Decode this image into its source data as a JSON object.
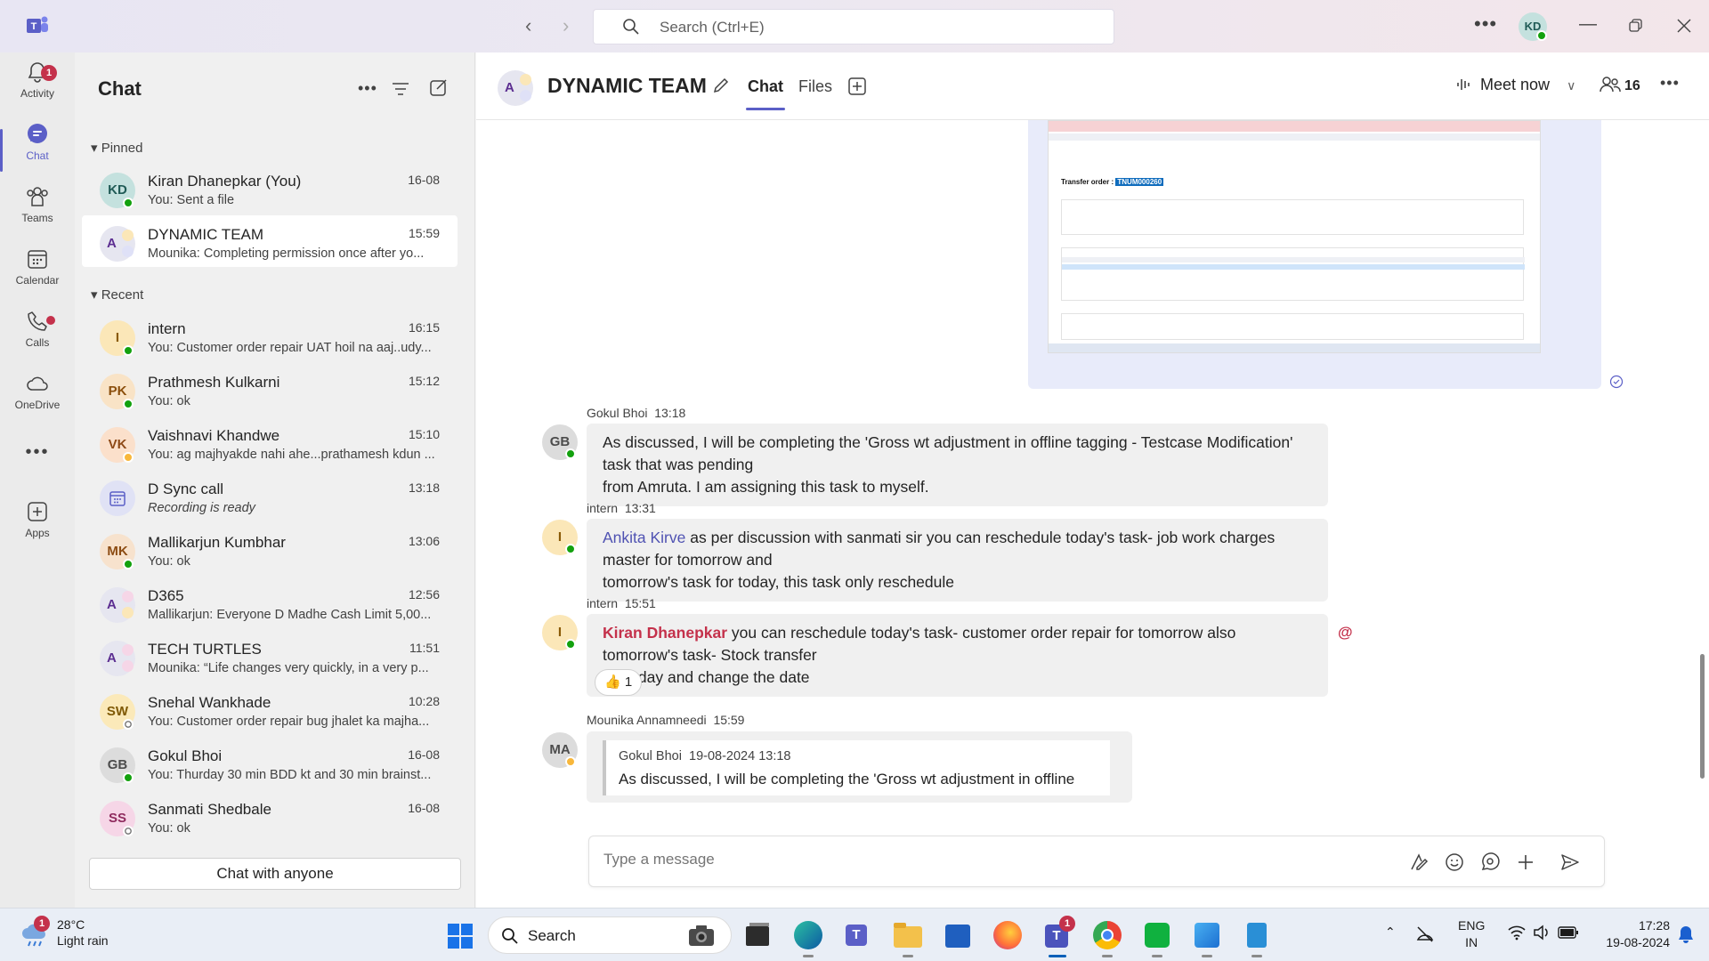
{
  "titlebar": {
    "search_placeholder": "Search (Ctrl+E)",
    "avatar": "KD"
  },
  "rail": {
    "items": [
      {
        "label": "Activity",
        "badge": "1"
      },
      {
        "label": "Chat"
      },
      {
        "label": "Teams"
      },
      {
        "label": "Calendar"
      },
      {
        "label": "Calls"
      },
      {
        "label": "OneDrive"
      },
      {
        "label": "..."
      },
      {
        "label": "Apps"
      }
    ]
  },
  "chatlist": {
    "title": "Chat",
    "pinned_label": "Pinned",
    "recent_label": "Recent",
    "pinned": [
      {
        "initials": "KD",
        "name": "Kiran Dhanepkar (You)",
        "time": "16-08",
        "preview": "You: Sent a file"
      },
      {
        "initials": "A",
        "name": "DYNAMIC TEAM",
        "time": "15:59",
        "preview": "Mounika: Completing permission once after yo..."
      }
    ],
    "recent": [
      {
        "initials": "I",
        "name": "intern",
        "time": "16:15",
        "preview": "You: Customer order repair UAT hoil na aaj..udy..."
      },
      {
        "initials": "PK",
        "name": "Prathmesh Kulkarni",
        "time": "15:12",
        "preview": "You: ok"
      },
      {
        "initials": "VK",
        "name": "Vaishnavi Khandwe",
        "time": "15:10",
        "preview": "You: ag majhyakde nahi ahe...prathamesh kdun ..."
      },
      {
        "initials": "",
        "name": "D Sync call",
        "time": "13:18",
        "preview": "Recording is ready"
      },
      {
        "initials": "MK",
        "name": "Mallikarjun Kumbhar",
        "time": "13:06",
        "preview": "You: ok"
      },
      {
        "initials": "A",
        "name": "D365",
        "time": "12:56",
        "preview": "Mallikarjun: Everyone D Madhe Cash Limit  5,00..."
      },
      {
        "initials": "A",
        "name": "TECH TURTLES",
        "time": "11:51",
        "preview": "Mounika: “Life changes very quickly, in a very p..."
      },
      {
        "initials": "SW",
        "name": "Snehal Wankhade",
        "time": "10:28",
        "preview": "You: Customer order repair bug jhalet ka majha..."
      },
      {
        "initials": "GB",
        "name": "Gokul Bhoi",
        "time": "16-08",
        "preview": "You: Thurday 30 min BDD kt and 30 min brainst..."
      },
      {
        "initials": "SS",
        "name": "Sanmati Shedbale",
        "time": "16-08",
        "preview": "You: ok"
      }
    ],
    "chat_with_anyone": "Chat with anyone"
  },
  "main": {
    "title": "DYNAMIC TEAM",
    "tabs": [
      "Chat",
      "Files"
    ],
    "meet_now": "Meet now",
    "participants": "16",
    "screenshot": {
      "transfer_order_label": "Transfer order :",
      "transfer_order_id": "TNUM000260"
    },
    "messages": [
      {
        "initials": "GB",
        "sender": "Gokul Bhoi",
        "time": "13:18",
        "text1": "As discussed, I will be completing the 'Gross wt adjustment in offline tagging - Testcase Modification' task that was pending",
        "text2": "from Amruta. I am assigning this task to myself."
      },
      {
        "initials": "I",
        "sender": "intern",
        "time": "13:31",
        "mention": "Ankita Kirve",
        "text1": " as per discussion with sanmati sir you can reschedule today's task- job work charges master for tomorrow and",
        "text2": "tomorrow's task for today, this task only reschedule"
      },
      {
        "initials": "I",
        "sender": "intern",
        "time": "15:51",
        "mention": "Kiran Dhanepkar",
        "text1": " you can reschedule today's task- customer order repair for tomorrow also tomorrow's task- Stock transfer",
        "text2": "for today and change the date",
        "reaction": "1",
        "at": "@"
      },
      {
        "initials": "MA",
        "sender": "Mounika Annamneedi",
        "time": "15:59",
        "quote_sender": "Gokul Bhoi",
        "quote_time": "19-08-2024 13:18",
        "quote_text": "As discussed, I will be completing the 'Gross wt adjustment in offline"
      }
    ],
    "compose_placeholder": "Type a message"
  },
  "taskbar": {
    "weather_badge": "1",
    "temperature": "28°C",
    "condition": "Light rain",
    "search_label": "Search",
    "teams_badge": "1",
    "lang1": "ENG",
    "lang2": "IN",
    "time": "17:28",
    "date": "19-08-2024"
  },
  "colors": {
    "accent": "#5b5fc7",
    "available": "#13a10e",
    "away": "#f8b73b",
    "mention_me": "#c4314b"
  }
}
